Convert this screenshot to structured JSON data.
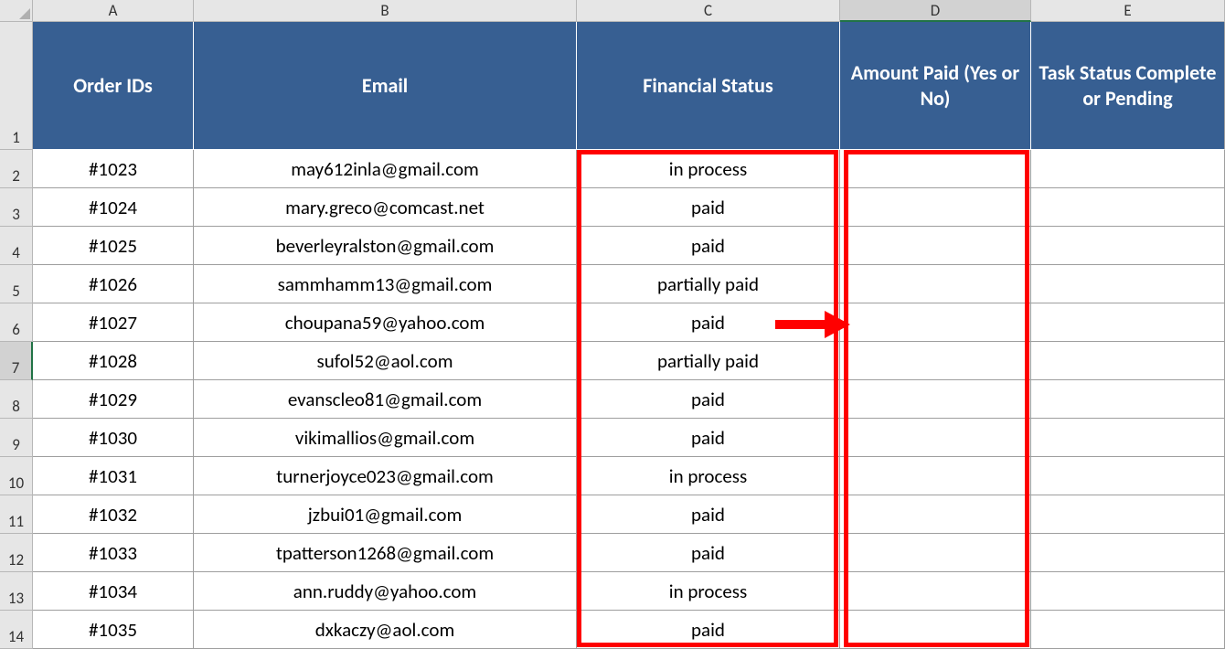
{
  "columns": [
    "A",
    "B",
    "C",
    "D",
    "E"
  ],
  "selected_column": "D",
  "selected_row": 7,
  "headers": {
    "A": "Order IDs",
    "B": "Email",
    "C": "Financial Status",
    "D": "Amount Paid (Yes or No)",
    "E": "Task Status Complete or Pending"
  },
  "rows": [
    {
      "n": 2,
      "A": "#1023",
      "B": "may612inla@gmail.com",
      "C": "in process",
      "D": "",
      "E": ""
    },
    {
      "n": 3,
      "A": "#1024",
      "B": "mary.greco@comcast.net",
      "C": "paid",
      "D": "",
      "E": ""
    },
    {
      "n": 4,
      "A": "#1025",
      "B": "beverleyralston@gmail.com",
      "C": "paid",
      "D": "",
      "E": ""
    },
    {
      "n": 5,
      "A": "#1026",
      "B": "sammhamm13@gmail.com",
      "C": "partially paid",
      "D": "",
      "E": ""
    },
    {
      "n": 6,
      "A": "#1027",
      "B": "choupana59@yahoo.com",
      "C": "paid",
      "D": "",
      "E": ""
    },
    {
      "n": 7,
      "A": "#1028",
      "B": "sufol52@aol.com",
      "C": "partially paid",
      "D": "",
      "E": ""
    },
    {
      "n": 8,
      "A": "#1029",
      "B": "evanscleo81@gmail.com",
      "C": "paid",
      "D": "",
      "E": ""
    },
    {
      "n": 9,
      "A": "#1030",
      "B": "vikimallios@gmail.com",
      "C": "paid",
      "D": "",
      "E": ""
    },
    {
      "n": 10,
      "A": "#1031",
      "B": "turnerjoyce023@gmail.com",
      "C": "in process",
      "D": "",
      "E": ""
    },
    {
      "n": 11,
      "A": "#1032",
      "B": "jzbui01@gmail.com",
      "C": "paid",
      "D": "",
      "E": ""
    },
    {
      "n": 12,
      "A": "#1033",
      "B": "tpatterson1268@gmail.com",
      "C": "paid",
      "D": "",
      "E": ""
    },
    {
      "n": 13,
      "A": "#1034",
      "B": "ann.ruddy@yahoo.com",
      "C": "in process",
      "D": "",
      "E": ""
    },
    {
      "n": 14,
      "A": "#1035",
      "B": "dxkaczy@aol.com",
      "C": "paid",
      "D": "",
      "E": ""
    }
  ],
  "annotations": {
    "highlight_columns": [
      "C",
      "D"
    ],
    "arrow_from": "C6",
    "arrow_to": "D6"
  },
  "chart_data": {
    "type": "table",
    "title": "",
    "columns": [
      "Order IDs",
      "Email",
      "Financial Status",
      "Amount Paid (Yes or No)",
      "Task Status Complete or Pending"
    ],
    "data": [
      [
        "#1023",
        "may612inla@gmail.com",
        "in process",
        "",
        ""
      ],
      [
        "#1024",
        "mary.greco@comcast.net",
        "paid",
        "",
        ""
      ],
      [
        "#1025",
        "beverleyralston@gmail.com",
        "paid",
        "",
        ""
      ],
      [
        "#1026",
        "sammhamm13@gmail.com",
        "partially paid",
        "",
        ""
      ],
      [
        "#1027",
        "choupana59@yahoo.com",
        "paid",
        "",
        ""
      ],
      [
        "#1028",
        "sufol52@aol.com",
        "partially paid",
        "",
        ""
      ],
      [
        "#1029",
        "evanscleo81@gmail.com",
        "paid",
        "",
        ""
      ],
      [
        "#1030",
        "vikimallios@gmail.com",
        "paid",
        "",
        ""
      ],
      [
        "#1031",
        "turnerjoyce023@gmail.com",
        "in process",
        "",
        ""
      ],
      [
        "#1032",
        "jzbui01@gmail.com",
        "paid",
        "",
        ""
      ],
      [
        "#1033",
        "tpatterson1268@gmail.com",
        "paid",
        "",
        ""
      ],
      [
        "#1034",
        "ann.ruddy@yahoo.com",
        "in process",
        "",
        ""
      ],
      [
        "#1035",
        "dxkaczy@aol.com",
        "paid",
        "",
        ""
      ]
    ]
  }
}
